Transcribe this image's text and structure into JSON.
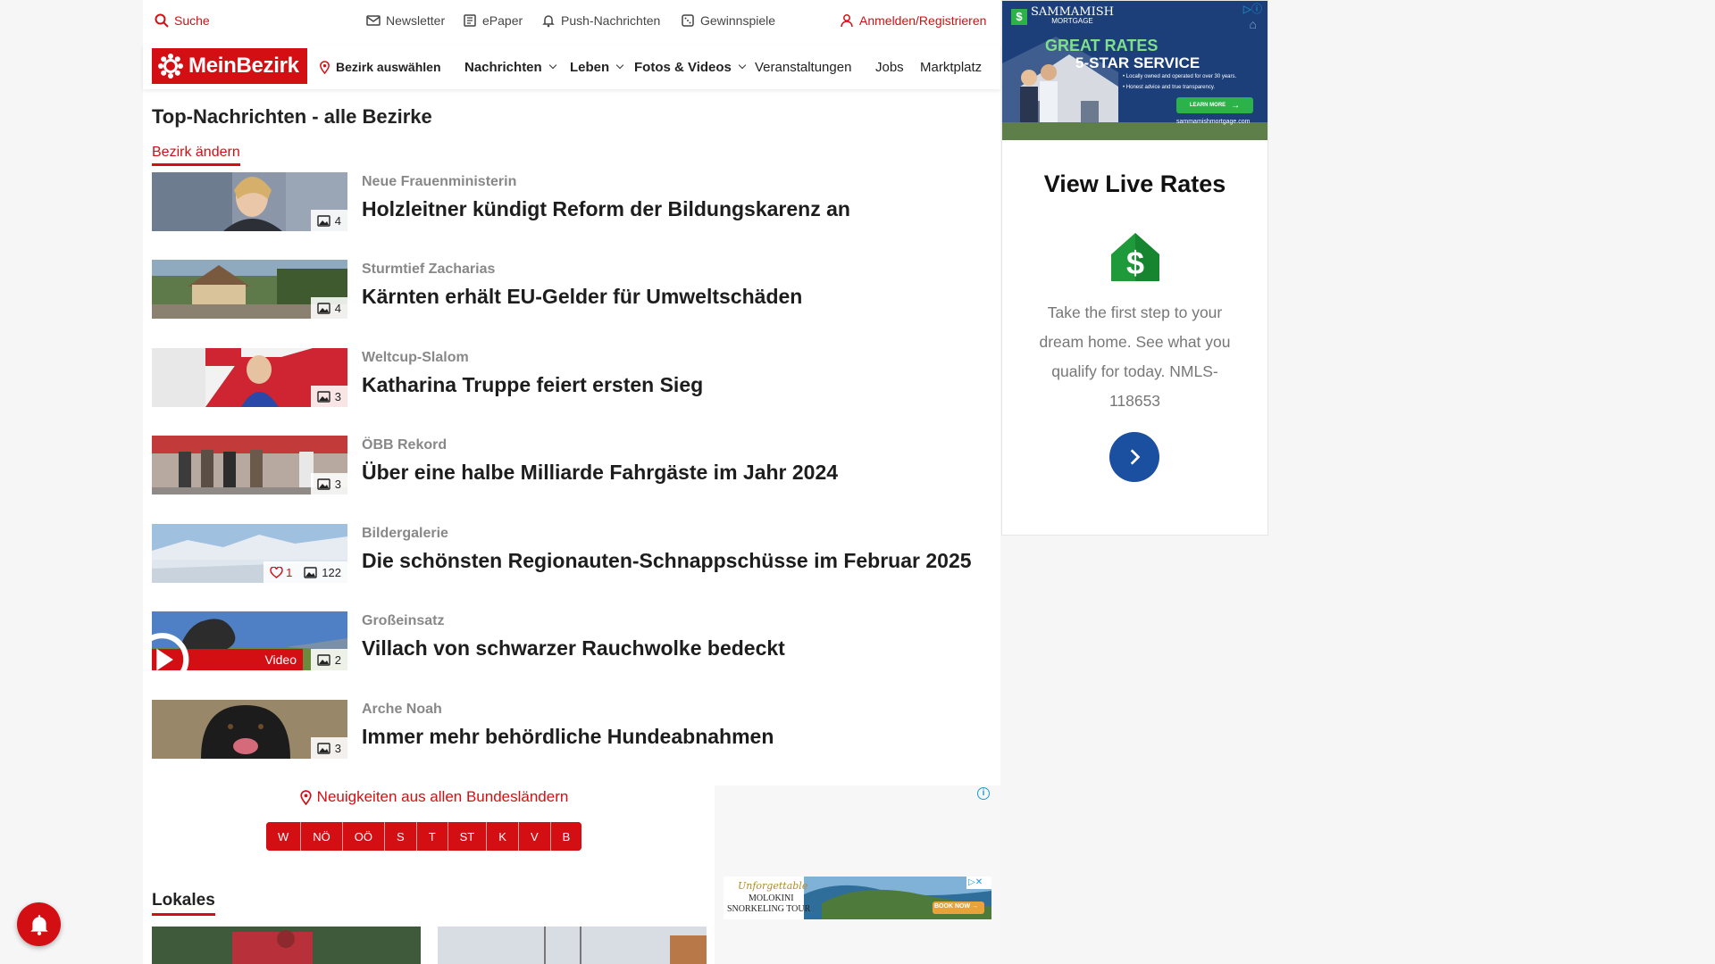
{
  "utility_bar": {
    "search": "Suche",
    "newsletter": "Newsletter",
    "epaper": "ePaper",
    "push": "Push-Nachrichten",
    "games": "Gewinnspiele",
    "login": "Anmelden/Registrieren"
  },
  "nav": {
    "logo": "MeinBezirk",
    "district": "Bezirk auswählen",
    "items": [
      {
        "label": "Nachrichten",
        "dropdown": true
      },
      {
        "label": "Leben",
        "dropdown": true
      },
      {
        "label": "Fotos & Videos",
        "dropdown": true
      },
      {
        "label": "Veranstaltungen",
        "dropdown": false
      },
      {
        "label": "Jobs",
        "dropdown": false
      },
      {
        "label": "Marktplatz",
        "dropdown": false
      }
    ]
  },
  "main": {
    "heading": "Top-Nachrichten - alle Bezirke",
    "change_district": "Bezirk ändern",
    "articles": [
      {
        "kicker": "Neue Frauenministerin",
        "title": "Holzleitner kündigt Reform der Bildungskarenz an",
        "photos": "4"
      },
      {
        "kicker": "Sturmtief Zacharias",
        "title": "Kärnten erhält EU-Gelder für Umweltschäden",
        "photos": "4"
      },
      {
        "kicker": "Weltcup-Slalom",
        "title": "Katharina Truppe feiert ersten Sieg",
        "photos": "3"
      },
      {
        "kicker": "ÖBB Rekord",
        "title": "Über eine halbe Milliarde Fahrgäste im Jahr 2024",
        "photos": "3"
      },
      {
        "kicker": "Bildergalerie",
        "title": "Die schönsten Regionauten-Schnappschüsse im Februar 2025",
        "photos": "122",
        "likes": "1"
      },
      {
        "kicker": "Großeinsatz",
        "title": "Villach von schwarzer Rauchwolke bedeckt",
        "photos": "2",
        "video": "Video"
      },
      {
        "kicker": "Arche Noah",
        "title": "Immer mehr behördliche Hundeabnahmen",
        "photos": "3"
      }
    ],
    "regions_label": "Neuigkeiten aus allen Bundesländern",
    "regions": [
      "W",
      "NÖ",
      "OÖ",
      "S",
      "T",
      "ST",
      "K",
      "V",
      "B"
    ],
    "lokales": "Lokales"
  },
  "ad_right": {
    "brand": "SAMMAMISH",
    "brand_sub": "MORTGAGE",
    "headline1": "GREAT RATES",
    "headline2": "5-STAR SERVICE",
    "bullet1": "• Locally owned and operated for over 30 years.",
    "bullet2": "• Honest advice and true transparency.",
    "cta_small": "LEARN MORE",
    "url": "sammamishmortgage.com",
    "title": "View Live Rates",
    "text": "Take the first step to your dream home. See what you qualify for today. NMLS-118653"
  },
  "ad_bottom": {
    "script_text": "Unforgettable",
    "line1": "MOLOKINI",
    "line2": "SNORKELING TOUR",
    "cta": "BOOK NOW →"
  },
  "colors": {
    "brand_red": "#d40f14",
    "ad_blue": "#1b4fa0",
    "ad_green": "#2bb34a"
  }
}
